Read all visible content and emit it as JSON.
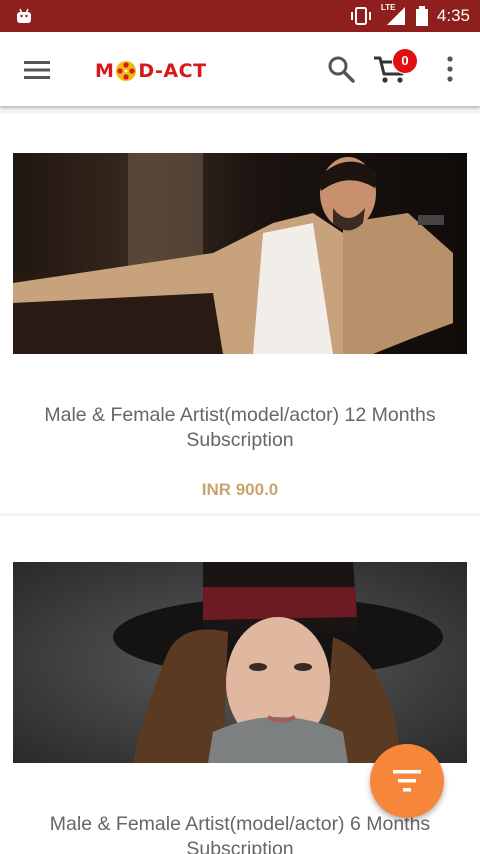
{
  "status_bar": {
    "time": "4:35",
    "network": "LTE"
  },
  "app_bar": {
    "logo_text_left": "M",
    "logo_text_right": "D-ACT",
    "cart_count": "0"
  },
  "products": [
    {
      "title": "Male & Female  Artist(model/actor) 12 Months Subscription",
      "price": "INR 900.0"
    },
    {
      "title": "Male & Female Artist(model/actor) 6 Months Subscription"
    }
  ],
  "colors": {
    "status_bar": "#8e1f1d",
    "logo": "#d7191b",
    "price": "#c8a46e",
    "fab": "#f6873a",
    "badge": "#e01010"
  }
}
